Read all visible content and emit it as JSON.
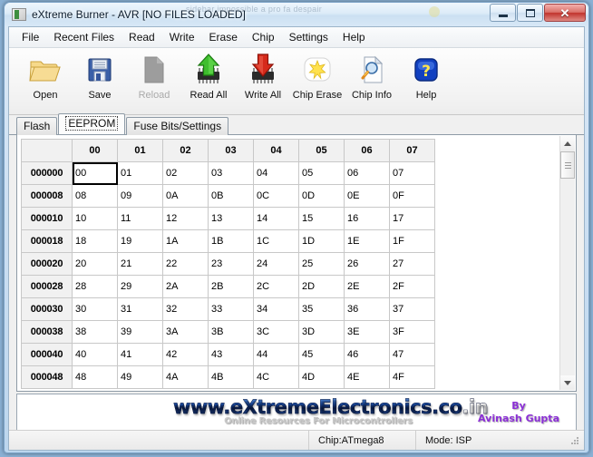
{
  "window": {
    "title": "eXtreme Burner - AVR [NO FILES LOADED]",
    "ghost_text": "sidebar impossible a pro fa despair",
    "icon": "app-icon",
    "buttons": {
      "minimize": "minimize-icon",
      "maximize": "maximize-icon",
      "close": "✕"
    }
  },
  "menubar": {
    "items": [
      {
        "label": "File"
      },
      {
        "label": "Recent Files"
      },
      {
        "label": "Read"
      },
      {
        "label": "Write"
      },
      {
        "label": "Erase"
      },
      {
        "label": "Chip"
      },
      {
        "label": "Settings"
      },
      {
        "label": "Help"
      }
    ]
  },
  "toolbar": {
    "items": [
      {
        "label": "Open",
        "icon": "folder-open-icon",
        "enabled": true
      },
      {
        "label": "Save",
        "icon": "floppy-disk-icon",
        "enabled": true
      },
      {
        "label": "Reload",
        "icon": "document-icon",
        "enabled": false
      },
      {
        "label": "Read All",
        "icon": "chip-up-arrow-icon",
        "enabled": true
      },
      {
        "label": "Write All",
        "icon": "chip-down-arrow-icon",
        "enabled": true
      },
      {
        "label": "Chip Erase",
        "icon": "sparkle-icon",
        "enabled": true
      },
      {
        "label": "Chip Info",
        "icon": "document-magnifier-icon",
        "enabled": true
      },
      {
        "label": "Help",
        "icon": "question-mark-icon",
        "enabled": true
      }
    ]
  },
  "tabs": {
    "items": [
      {
        "label": "Flash",
        "active": false
      },
      {
        "label": "EEPROM",
        "active": true
      },
      {
        "label": "Fuse Bits/Settings",
        "active": false
      }
    ]
  },
  "hexgrid": {
    "column_headers": [
      "00",
      "01",
      "02",
      "03",
      "04",
      "05",
      "06",
      "07"
    ],
    "selected_cell": {
      "row": 0,
      "col": 0
    },
    "rows": [
      {
        "address": "000000",
        "values": [
          "00",
          "01",
          "02",
          "03",
          "04",
          "05",
          "06",
          "07"
        ]
      },
      {
        "address": "000008",
        "values": [
          "08",
          "09",
          "0A",
          "0B",
          "0C",
          "0D",
          "0E",
          "0F"
        ]
      },
      {
        "address": "000010",
        "values": [
          "10",
          "11",
          "12",
          "13",
          "14",
          "15",
          "16",
          "17"
        ]
      },
      {
        "address": "000018",
        "values": [
          "18",
          "19",
          "1A",
          "1B",
          "1C",
          "1D",
          "1E",
          "1F"
        ]
      },
      {
        "address": "000020",
        "values": [
          "20",
          "21",
          "22",
          "23",
          "24",
          "25",
          "26",
          "27"
        ]
      },
      {
        "address": "000028",
        "values": [
          "28",
          "29",
          "2A",
          "2B",
          "2C",
          "2D",
          "2E",
          "2F"
        ]
      },
      {
        "address": "000030",
        "values": [
          "30",
          "31",
          "32",
          "33",
          "34",
          "35",
          "36",
          "37"
        ]
      },
      {
        "address": "000038",
        "values": [
          "38",
          "39",
          "3A",
          "3B",
          "3C",
          "3D",
          "3E",
          "3F"
        ]
      },
      {
        "address": "000040",
        "values": [
          "40",
          "41",
          "42",
          "43",
          "44",
          "45",
          "46",
          "47"
        ]
      },
      {
        "address": "000048",
        "values": [
          "48",
          "49",
          "4A",
          "4B",
          "4C",
          "4D",
          "4E",
          "4F"
        ]
      }
    ]
  },
  "scrollbar": {
    "up_arrow": "scroll-up-icon",
    "down_arrow": "scroll-down-icon"
  },
  "banner": {
    "logo_main": "www.eXtremeElectronics.co.in",
    "logo_sub": "Online Resources For Microcontrollers",
    "by_line1": "By",
    "by_line2": "Avinash Gupta",
    "by_color": "#8b2fd6"
  },
  "statusbar": {
    "chip": "Chip:ATmega8",
    "mode": "Mode: ISP"
  }
}
